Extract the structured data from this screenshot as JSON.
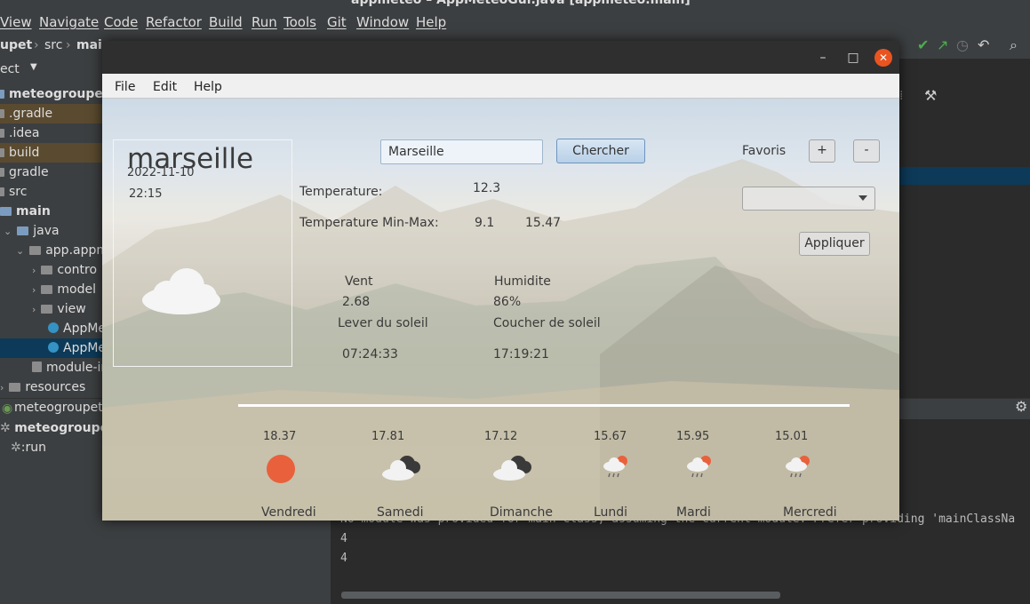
{
  "ide": {
    "title": "appmeteo – AppMeteoGui.java [appmeteo.main]",
    "menu": [
      "View",
      "Navigate",
      "Code",
      "Refactor",
      "Build",
      "Run",
      "Tools",
      "Git",
      "Window",
      "Help"
    ],
    "breadcrumbs": [
      "upet",
      "src",
      "mai"
    ],
    "project_label": "ect",
    "tree": [
      {
        "label": "meteogroupet [app",
        "style": "bold",
        "icon": "folder"
      },
      {
        "label": ".gradle",
        "style": "orange",
        "icon": "folder"
      },
      {
        "label": ".idea",
        "style": "normal",
        "icon": "folder"
      },
      {
        "label": "build",
        "style": "orange",
        "icon": "folder"
      },
      {
        "label": "gradle",
        "style": "normal",
        "icon": "folder"
      },
      {
        "label": "src",
        "style": "normal",
        "icon": "folder"
      },
      {
        "label": "main",
        "style": "bold",
        "icon": "folder"
      },
      {
        "label": "java",
        "style": "normal",
        "icon": "folder"
      },
      {
        "label": "app.appm",
        "style": "normal",
        "icon": "package"
      },
      {
        "label": "contro",
        "style": "normal",
        "icon": "package"
      },
      {
        "label": "model",
        "style": "normal",
        "icon": "package"
      },
      {
        "label": "view",
        "style": "normal",
        "icon": "package"
      },
      {
        "label": "AppMe",
        "style": "normal",
        "icon": "class"
      },
      {
        "label": "AppMe",
        "style": "blue",
        "icon": "class"
      },
      {
        "label": "module-in",
        "style": "normal",
        "icon": "file"
      },
      {
        "label": "resources",
        "style": "normal",
        "icon": "folder"
      }
    ],
    "run_tab": "meteogroupet",
    "run_tree": [
      {
        "label": "meteogroupet"
      },
      {
        "label": ":run"
      }
    ],
    "console_lines": [
      "No module was provided for main class, assuming the current module. Prefer providing 'mainClassNa",
      "4",
      "4"
    ]
  },
  "app": {
    "menu": {
      "file": "File",
      "edit": "Edit",
      "help": "Help"
    },
    "city": "marseille",
    "date": "2022-11-10",
    "time": "22:15",
    "search": {
      "value": "Marseille",
      "button": "Chercher"
    },
    "favoris": {
      "label": "Favoris",
      "add": "+",
      "remove": "-",
      "apply": "Appliquer"
    },
    "temperature": {
      "label": "Temperature:",
      "value": "12.3"
    },
    "temp_minmax": {
      "label": "Temperature Min-Max:",
      "min": "9.1",
      "max": "15.47"
    },
    "vent": {
      "label": "Vent",
      "value": "2.68"
    },
    "humidite": {
      "label": "Humidite",
      "value": "86%"
    },
    "lever": {
      "label": "Lever du soleil",
      "value": "07:24:33"
    },
    "coucher": {
      "label": "Coucher de soleil",
      "value": "17:19:21"
    },
    "forecast": [
      {
        "day": "Vendredi",
        "temp": "18.37",
        "icon": "sun-icon"
      },
      {
        "day": "Samedi",
        "temp": "17.81",
        "icon": "cloudy-icon"
      },
      {
        "day": "Dimanche",
        "temp": "17.12",
        "icon": "cloudy-icon"
      },
      {
        "day": "Lundi",
        "temp": "15.67",
        "icon": "rain-sun-icon"
      },
      {
        "day": "Mardi",
        "temp": "15.95",
        "icon": "rain-sun-icon"
      },
      {
        "day": "Mercredi",
        "temp": "15.01",
        "icon": "rain-sun-icon"
      }
    ]
  }
}
